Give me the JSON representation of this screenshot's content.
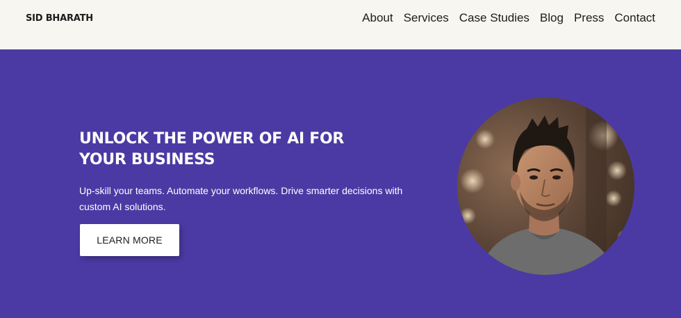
{
  "header": {
    "logo": "SID BHARATH",
    "nav": [
      "About",
      "Services",
      "Case Studies",
      "Blog",
      "Press",
      "Contact"
    ]
  },
  "hero": {
    "headline_line1": "UNLOCK THE POWER OF AI FOR",
    "headline_line2": "YOUR BUSINESS",
    "subtext_line1": "Up-skill your teams. Automate your workflows. Drive smarter decisions with",
    "subtext_line2": "custom AI solutions.",
    "cta_label": "LEARN MORE"
  },
  "colors": {
    "hero_bg": "#4b3aa3",
    "header_bg": "#f8f6f0",
    "text_dark": "#1c1c1c"
  }
}
